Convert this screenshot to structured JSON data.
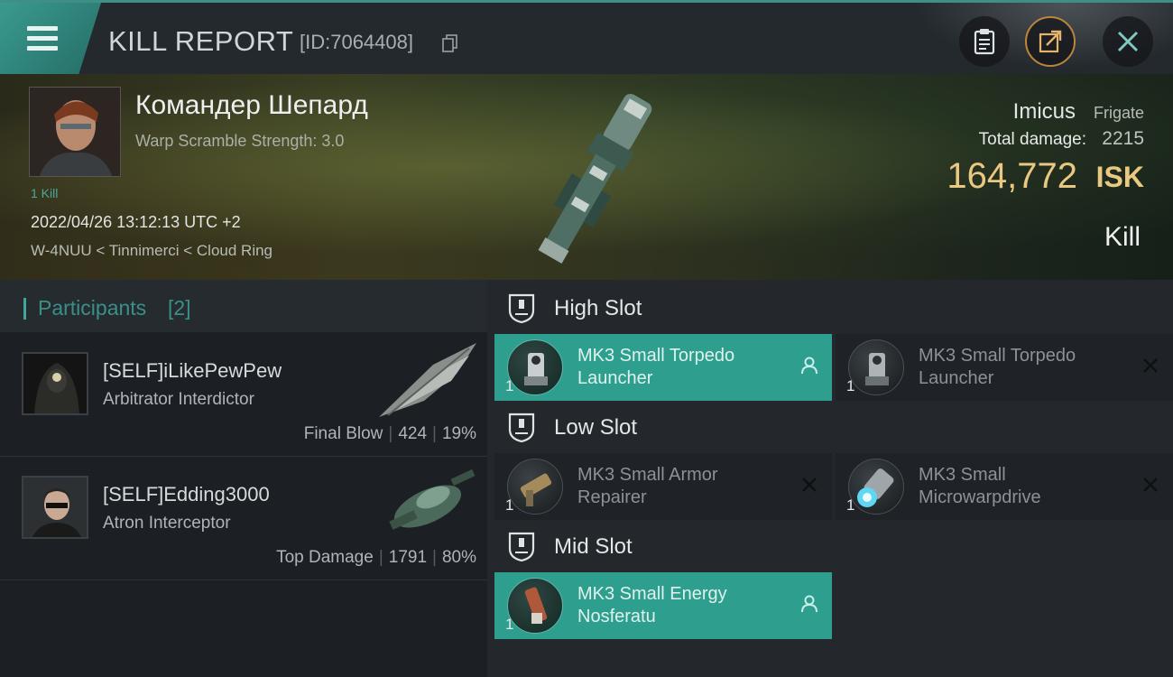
{
  "header": {
    "title": "KILL REPORT",
    "report_id": "[ID:7064408]",
    "icons": [
      "menu-icon",
      "copy-icon",
      "clipboard-icon",
      "share-icon",
      "close-icon"
    ]
  },
  "victim": {
    "name": "Командер Шепард",
    "warp_scramble": "Warp Scramble Strength: 3.0",
    "kill_count": "1 Kill",
    "datetime": "2022/04/26 13:12:13 UTC +2",
    "location": "W-4NUU < Tinnimerci < Cloud Ring"
  },
  "ship": {
    "name": "Imicus",
    "class": "Frigate",
    "total_damage_label": "Total damage:",
    "total_damage": "2215",
    "isk_value": "164,772",
    "isk_unit": "ISK",
    "result": "Kill"
  },
  "participants": {
    "title": "Participants",
    "count": "[2]",
    "items": [
      {
        "name": "[SELF]iLikePewPew",
        "ship": "Arbitrator Interdictor",
        "role": "Final Blow",
        "damage": "424",
        "percent": "19%"
      },
      {
        "name": "[SELF]Edding3000",
        "ship": "Atron Interceptor",
        "role": "Top Damage",
        "damage": "1791",
        "percent": "80%"
      }
    ]
  },
  "slots": {
    "high": {
      "label": "High Slot",
      "modules": [
        {
          "qty": "1",
          "name": "MK3 Small Torpedo Launcher",
          "state": "fitted"
        },
        {
          "qty": "1",
          "name": "MK3 Small Torpedo Launcher",
          "state": "destroyed"
        }
      ]
    },
    "low": {
      "label": "Low Slot",
      "modules": [
        {
          "qty": "1",
          "name": "MK3 Small Armor Repairer",
          "state": "destroyed"
        },
        {
          "qty": "1",
          "name": "MK3 Small Microwarpdrive",
          "state": "destroyed"
        }
      ]
    },
    "mid": {
      "label": "Mid Slot",
      "modules": [
        {
          "qty": "1",
          "name": "MK3 Small Energy Nosferatu",
          "state": "fitted"
        }
      ]
    }
  },
  "colors": {
    "accent_teal": "#2e9f8e",
    "isk_gold": "#e9c882",
    "share_ring": "#b9853d"
  }
}
